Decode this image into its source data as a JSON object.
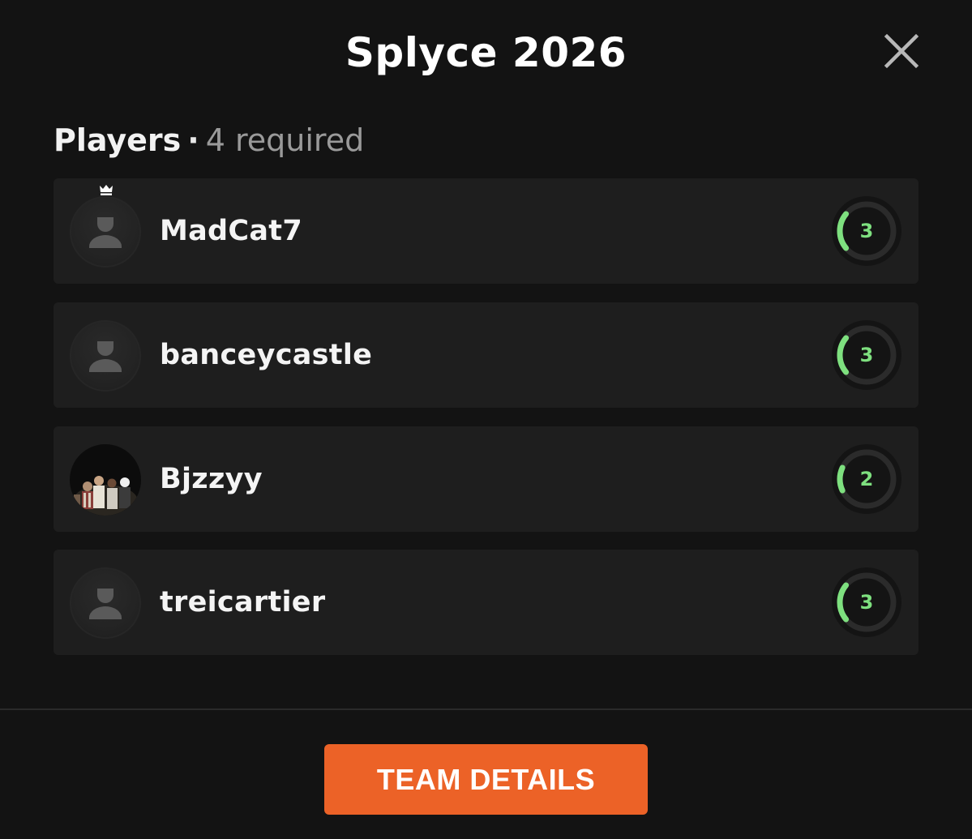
{
  "modal": {
    "title": "Splyce 2026"
  },
  "players_section": {
    "label": "Players",
    "separator": "·",
    "required_count": "4",
    "required_word": "required"
  },
  "players": [
    {
      "name": "MadCat7",
      "level": "3",
      "level_fraction": 0.22,
      "is_captain": true,
      "avatar": "default-avatar-icon"
    },
    {
      "name": "banceycastle",
      "level": "3",
      "level_fraction": 0.22,
      "is_captain": false,
      "avatar": "default-avatar-icon"
    },
    {
      "name": "Bjzzyy",
      "level": "2",
      "level_fraction": 0.14,
      "is_captain": false,
      "avatar": "photo"
    },
    {
      "name": "treicartier",
      "level": "3",
      "level_fraction": 0.22,
      "is_captain": false,
      "avatar": "default-avatar-icon"
    }
  ],
  "footer": {
    "team_details_label": "TEAM DETAILS"
  },
  "icons": {
    "close": "close-icon",
    "captain": "crown-icon",
    "default_avatar": "user-silhouette-icon"
  },
  "colors": {
    "background": "#131313",
    "card": "#1e1e1e",
    "accent_button": "#ec6227",
    "level_green": "#7ee07f",
    "ring_track": "#2b2b2b"
  }
}
